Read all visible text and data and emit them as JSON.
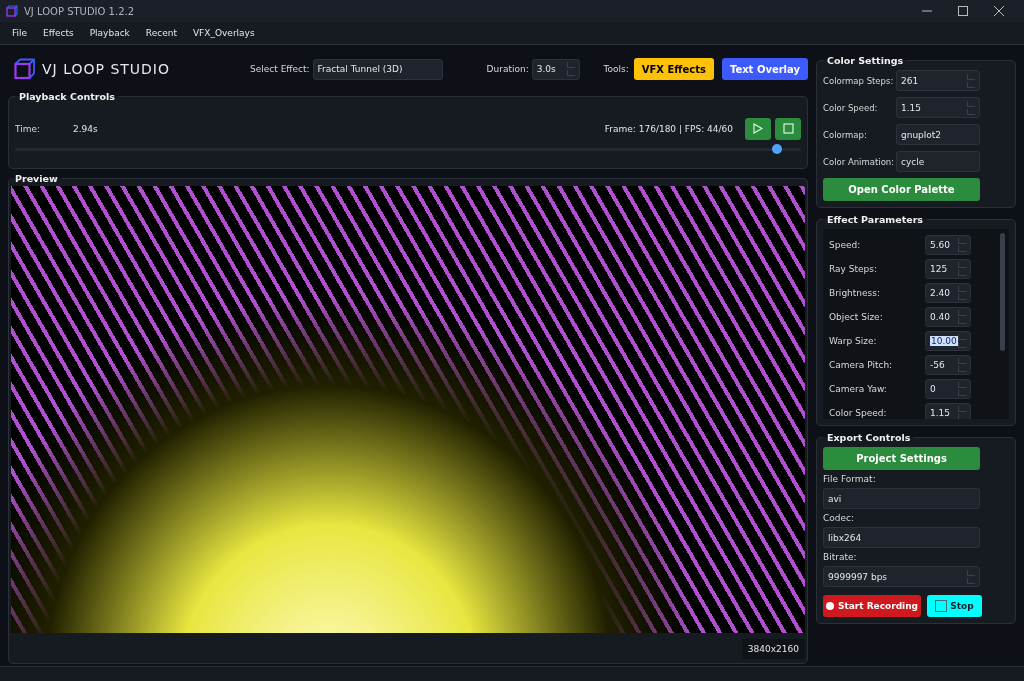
{
  "window": {
    "title": "VJ LOOP STUDIO 1.2.2"
  },
  "menu": [
    "File",
    "Effects",
    "Playback",
    "Recent",
    "VFX_Overlays"
  ],
  "header": {
    "logo": "VJ LOOP STUDIO",
    "effect_label": "Select Effect:",
    "effect_value": "Fractal Tunnel (3D)",
    "duration_label": "Duration:",
    "duration_value": "3.0s",
    "tools_label": "Tools:",
    "tools": [
      {
        "label": "VFX Effects",
        "color": "#ffc107"
      },
      {
        "label": "Text Overlay",
        "color": "#3d5afe"
      }
    ]
  },
  "playback": {
    "title": "Playback Controls",
    "time_label": "Time:",
    "time_value": "2.94s",
    "frame_info": "Frame: 176/180 | FPS: 44/60",
    "level": 0.97
  },
  "preview": {
    "title": "Preview",
    "resolution": "3840x2160"
  },
  "color_settings": {
    "title": "Color Settings",
    "fields": [
      {
        "label": "Colormap Steps:",
        "value": "261",
        "kind": "spin"
      },
      {
        "label": "Color Speed:",
        "value": "1.15",
        "kind": "spin"
      },
      {
        "label": "Colormap:",
        "value": "gnuplot2",
        "kind": "text"
      },
      {
        "label": "Color Animation:",
        "value": "cycle",
        "kind": "text"
      }
    ],
    "button": "Open Color Palette"
  },
  "effect_parameters": {
    "title": "Effect Parameters",
    "params": [
      {
        "label": "Speed:",
        "value": "5.60",
        "selected": false
      },
      {
        "label": "Ray Steps:",
        "value": "125",
        "selected": false
      },
      {
        "label": "Brightness:",
        "value": "2.40",
        "selected": false
      },
      {
        "label": "Object Size:",
        "value": "0.40",
        "selected": false
      },
      {
        "label": "Warp Size:",
        "value": "10.00",
        "selected": true
      },
      {
        "label": "Camera Pitch:",
        "value": "-56",
        "selected": false
      },
      {
        "label": "Camera Yaw:",
        "value": "0",
        "selected": false
      },
      {
        "label": "Color Speed:",
        "value": "1.15",
        "selected": false
      }
    ]
  },
  "export": {
    "title": "Export Controls",
    "settings_button": "Project Settings",
    "fields": [
      {
        "label": "File Format:",
        "value": "avi",
        "kind": "text"
      },
      {
        "label": "Codec:",
        "value": "libx264",
        "kind": "text"
      },
      {
        "label": "Bitrate:",
        "value": "9999997 bps",
        "kind": "spin"
      }
    ],
    "record_button": "Start Recording",
    "stop_button": "Stop"
  }
}
